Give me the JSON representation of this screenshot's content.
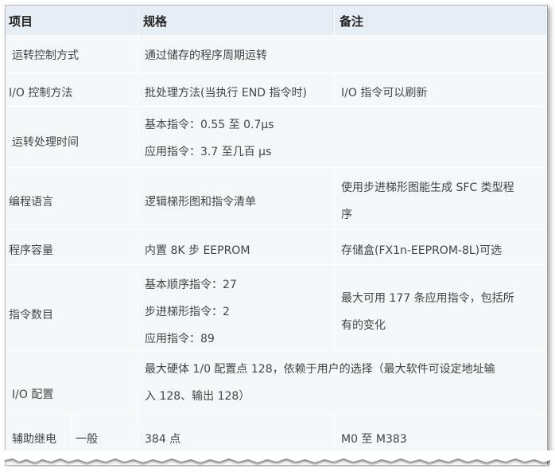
{
  "headers": {
    "item": "项目",
    "spec": "规格",
    "note": "备注"
  },
  "rows": [
    {
      "item": "运转控制方式",
      "spec": "通过储存的程序周期运转",
      "note": ""
    },
    {
      "item": "I/O 控制方法",
      "spec": "批处理方法(当执行 END 指令时)",
      "note": "I/O 指令可以刷新"
    },
    {
      "item": "运转处理时间",
      "spec_lines": [
        "基本指令：0.55 至 0.7μs",
        "应用指令：3.7 至几百 μs"
      ],
      "note": ""
    },
    {
      "item": "编程语言",
      "spec": "逻辑梯形图和指令清单",
      "note_lines": [
        "使用步进梯形图能生成 SFC 类型程",
        "序"
      ]
    },
    {
      "item": "程序容量",
      "spec": "内置 8K 步 EEPROM",
      "note": "存储盒(FX1n-EEPROM-8L)可选"
    },
    {
      "item": "指令数目",
      "spec_lines": [
        "基本顺序指令：27",
        "步进梯形指令：2",
        "应用指令：89"
      ],
      "note_lines": [
        "最大可用 177 条应用指令，包括所",
        "有的变化"
      ]
    },
    {
      "item": "I/O 配置",
      "spec_lines": [
        "最大硬体 1/0 配置点 128，依赖于用户的选择（最大软件可设定地址输",
        "入 128、输出 128）"
      ]
    },
    {
      "item": "辅助继电",
      "sub": "一般",
      "spec": "384 点",
      "note": "M0 至 M383"
    }
  ]
}
